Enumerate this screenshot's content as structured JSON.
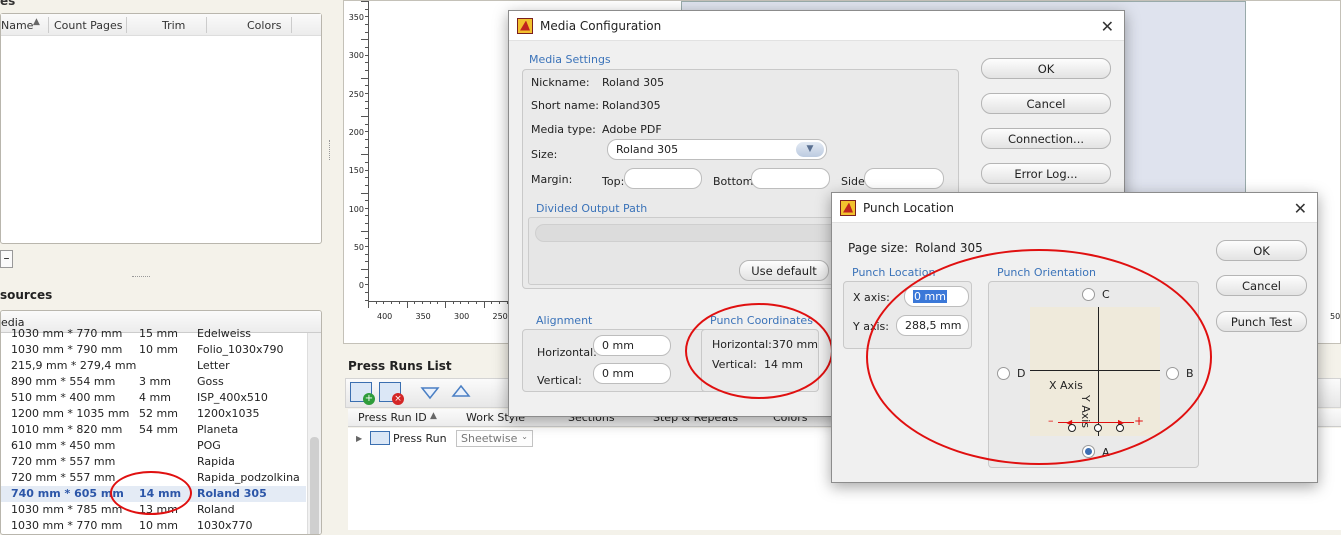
{
  "left_panel": {
    "top_columns": [
      "es",
      "Name",
      "Count Pages",
      "Trim",
      "Colors"
    ],
    "resources_title": "sources",
    "media_header": "edia",
    "media_rows": [
      {
        "size": "1030 mm * 770 mm",
        "margin": "15 mm",
        "name": "Edelweiss"
      },
      {
        "size": "1030 mm * 790 mm",
        "margin": "10 mm",
        "name": "Folio_1030x790"
      },
      {
        "size": "215,9 mm * 279,4 mm",
        "margin": "",
        "name": "Letter"
      },
      {
        "size": "890 mm * 554 mm",
        "margin": "3 mm",
        "name": "Goss"
      },
      {
        "size": "510 mm * 400 mm",
        "margin": "4 mm",
        "name": "ISP_400x510"
      },
      {
        "size": "1200 mm * 1035 mm",
        "margin": "52 mm",
        "name": "1200x1035"
      },
      {
        "size": "1010 mm * 820 mm",
        "margin": "54 mm",
        "name": "Planeta"
      },
      {
        "size": "610 mm * 450 mm",
        "margin": "",
        "name": "POG"
      },
      {
        "size": "720 mm * 557 mm",
        "margin": "",
        "name": "Rapida"
      },
      {
        "size": "720 mm * 557 mm",
        "margin": "",
        "name": "Rapida_podzolkina"
      },
      {
        "size": "740 mm * 605 mm",
        "margin": "14 mm",
        "name": "Roland 305"
      },
      {
        "size": "1030 mm * 785 mm",
        "margin": "13 mm",
        "name": "Roland"
      },
      {
        "size": "1030 mm * 770 mm",
        "margin": "10 mm",
        "name": "1030x770"
      }
    ],
    "selected_row": 10
  },
  "ruler": {
    "y_ticks": [
      "350",
      "300",
      "250",
      "200",
      "150",
      "100",
      "50",
      "0"
    ],
    "x_ticks": [
      "400",
      "350",
      "300",
      "250"
    ],
    "right_tick": "50"
  },
  "press_runs": {
    "title": "Press Runs List",
    "columns": [
      "Press Run ID",
      "Work Style",
      "Sections",
      "Step & Repeats",
      "Colors"
    ],
    "row_label": "Press Run",
    "row_style": "Sheetwise"
  },
  "media_config": {
    "title": "Media Configuration",
    "settings_title": "Media Settings",
    "nickname_label": "Nickname:",
    "nickname": "Roland 305",
    "shortname_label": "Short name:",
    "shortname": "Roland305",
    "mediatype_label": "Media type:",
    "mediatype": "Adobe PDF",
    "size_label": "Size:",
    "size": "Roland 305",
    "margin_label": "Margin:",
    "top_label": "Top:",
    "bottom_label": "Bottom:",
    "side_label": "Side:",
    "divided_title": "Divided Output Path",
    "use_default": "Use default",
    "alignment_title": "Alignment",
    "horizontal_label": "Horizontal:",
    "horizontal": "0 mm",
    "vertical_label": "Vertical:",
    "vertical": "0 mm",
    "punch_coords_title": "Punch Coordinates",
    "punch_h_label": "Horizontal:",
    "punch_h": "370 mm",
    "punch_v_label": "Vertical:",
    "punch_v": "14 mm",
    "buttons": {
      "ok": "OK",
      "cancel": "Cancel",
      "connection": "Connection...",
      "errorlog": "Error Log..."
    }
  },
  "punch_location": {
    "title": "Punch Location",
    "page_size_label": "Page size:",
    "page_size": "Roland 305",
    "location_title": "Punch Location",
    "x_label": "X axis:",
    "x_value": "0 mm",
    "y_label": "Y axis:",
    "y_value": "288,5 mm",
    "orientation_title": "Punch Orientation",
    "radio_c": "C",
    "radio_d": "D",
    "radio_b": "B",
    "radio_a": "A",
    "x_axis_text": "X Axis",
    "y_axis_text": "Y Axis",
    "minus": "–",
    "plus": "+",
    "buttons": {
      "ok": "OK",
      "cancel": "Cancel",
      "test": "Punch Test"
    }
  }
}
